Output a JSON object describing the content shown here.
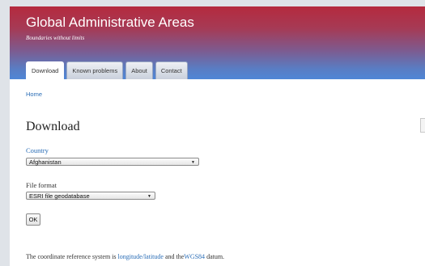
{
  "site": {
    "title": "Global Administrative Areas",
    "slogan": "Boundaries without limits"
  },
  "tabs": [
    {
      "label": "Download",
      "active": true
    },
    {
      "label": "Known problems",
      "active": false
    },
    {
      "label": "About",
      "active": false
    },
    {
      "label": "Contact",
      "active": false
    }
  ],
  "breadcrumb": {
    "home": "Home"
  },
  "main": {
    "title": "Download",
    "country": {
      "label": "Country",
      "selected": "Afghanistan"
    },
    "file_format": {
      "label": "File format",
      "selected": "ESRI file geodatabase"
    },
    "ok_label": "OK",
    "crs": {
      "prefix": "The coordinate reference system is ",
      "link1": "longitude/latitude",
      "middle": " and the",
      "link2": "WGS84",
      "suffix": " datum."
    }
  },
  "colors": {
    "header_top": "#b52a3e",
    "header_bottom": "#4f86d6",
    "link": "#2a6db6"
  }
}
